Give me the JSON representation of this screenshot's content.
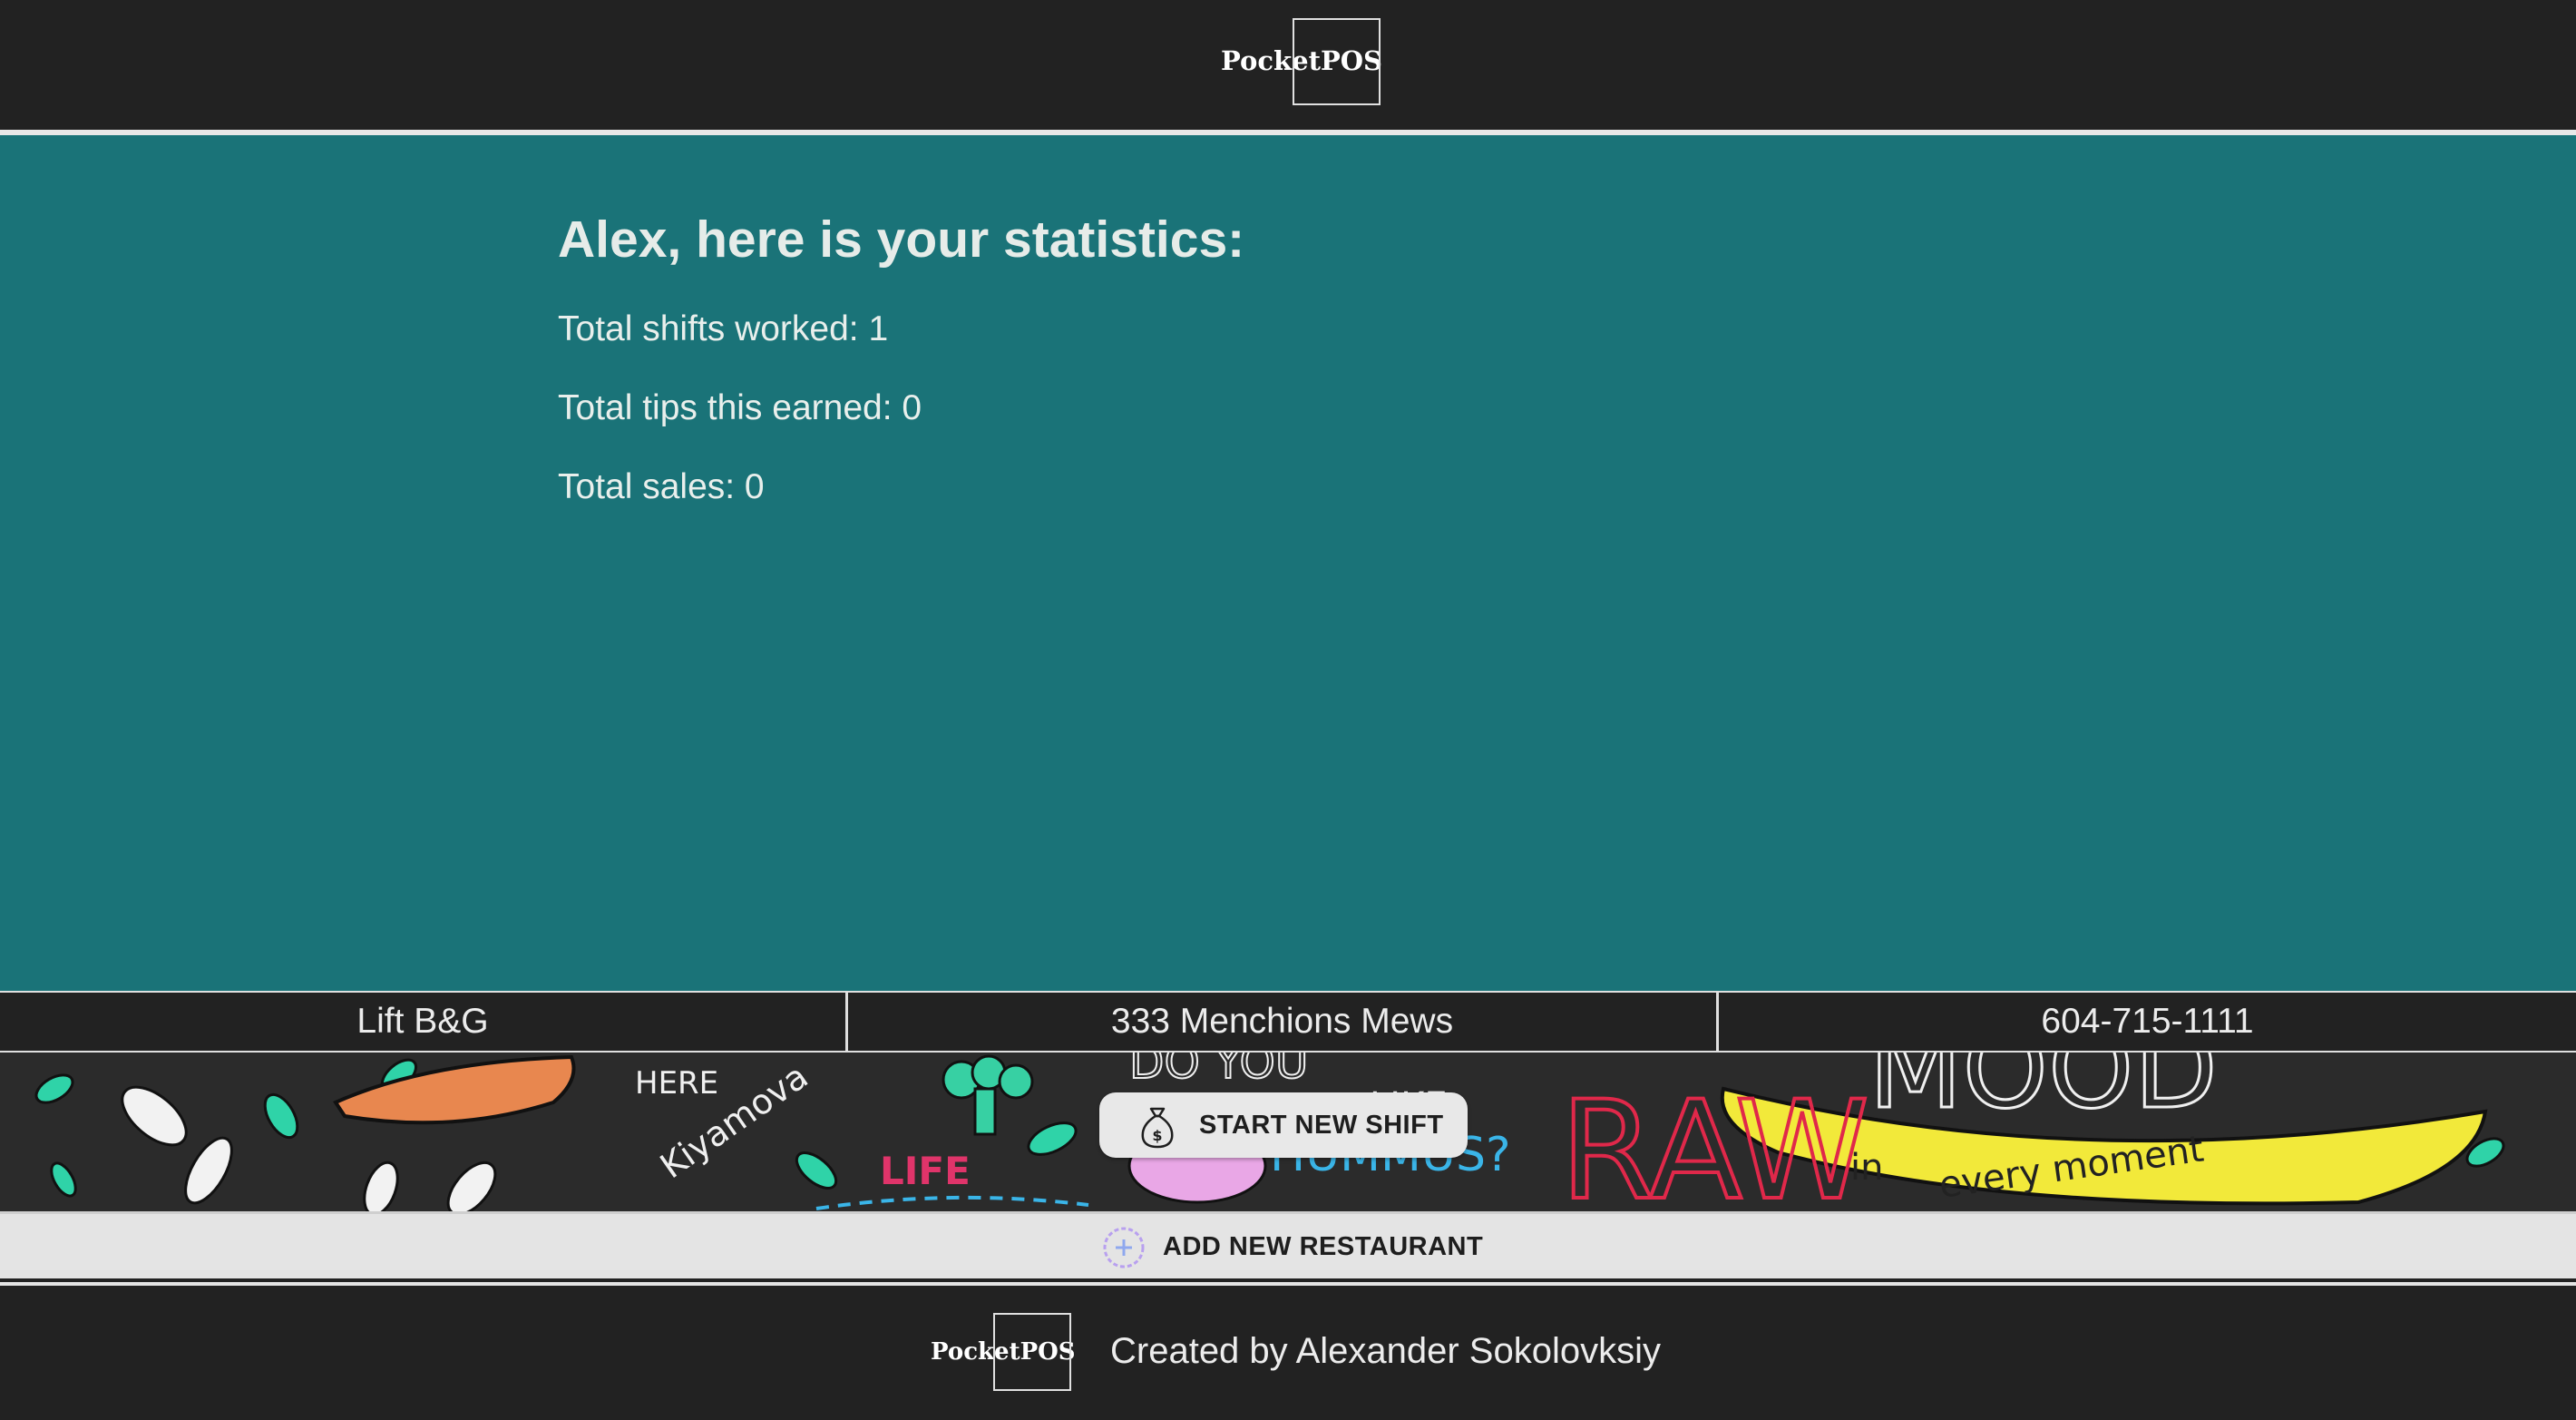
{
  "header": {
    "logo_text": "PocketPOS"
  },
  "stats": {
    "title": "Alex, here is your statistics:",
    "total_shifts": "Total shifts worked: 1",
    "total_tips": "Total tips this earned: 0",
    "total_sales": "Total sales: 0"
  },
  "restaurant": {
    "name": "Lift B&G",
    "address": "333 Menchions Mews",
    "phone": "604-715-1111"
  },
  "banner": {
    "doodle_words": [
      "HERE",
      "Kiyamova",
      "LIFE",
      "DO YOU",
      "LIKE",
      "HUMMUS?",
      "RAW",
      "MOOD",
      "in",
      "every moment"
    ]
  },
  "actions": {
    "start_shift_label": "START NEW SHIFT",
    "start_shift_icon": "money-bag-icon",
    "add_restaurant_label": "ADD NEW RESTAURANT",
    "add_restaurant_icon": "plus-circle-icon"
  },
  "footer": {
    "logo_text": "PocketPOS",
    "credit": "Created by Alexander Sokolovksiy"
  },
  "colors": {
    "header_bg": "#222222",
    "main_bg": "#1a7378",
    "button_bg": "#e8e8e8",
    "text_light": "#ececec"
  }
}
